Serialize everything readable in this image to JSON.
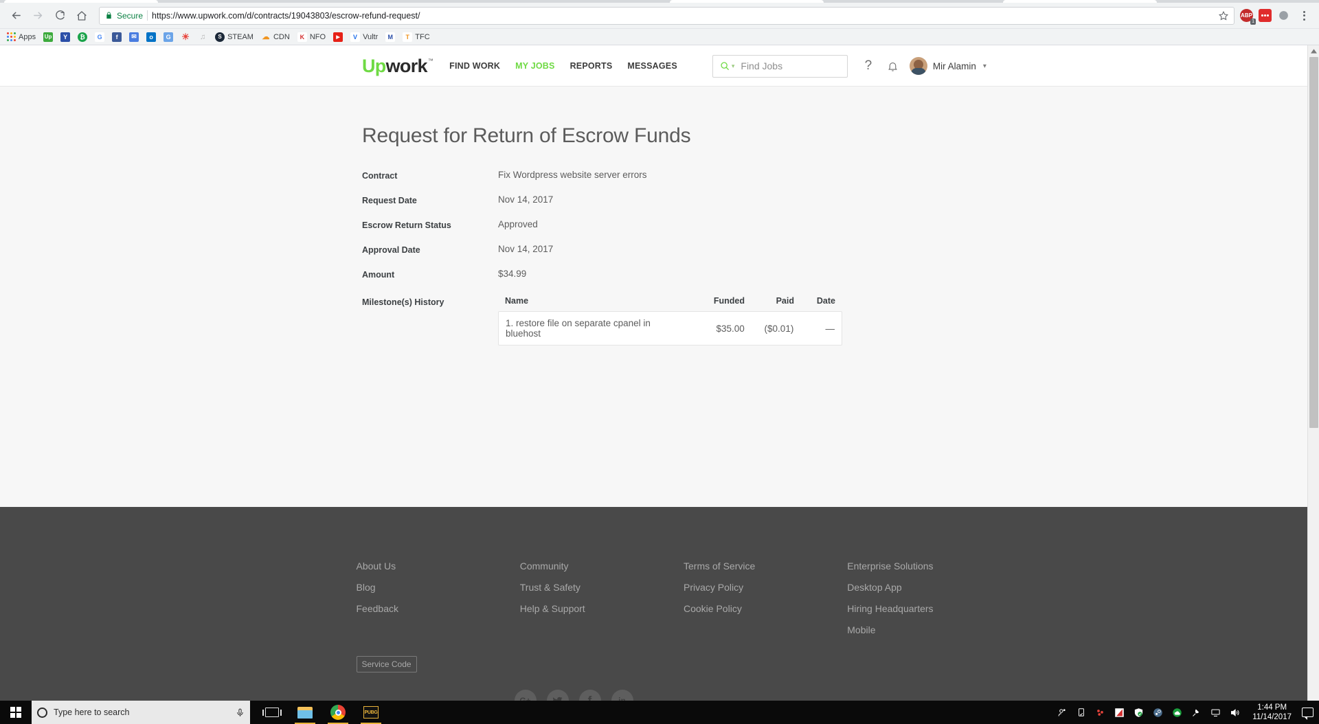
{
  "browser": {
    "nav": {
      "back": "back-arrow",
      "forward": "forward-arrow",
      "reload": "reload",
      "home": "home"
    },
    "security_label": "Secure",
    "url": "https://www.upwork.com/d/contracts/19043803/escrow-refund-request/",
    "extensions": [
      {
        "name": "adblock-plus",
        "label": "ABP",
        "badge": "1"
      },
      {
        "name": "red-dots-extension",
        "label": ""
      },
      {
        "name": "globe-extension",
        "label": ""
      }
    ],
    "bookmarks": [
      {
        "name": "apps",
        "label": "Apps",
        "icon": "apps-grid",
        "color": ""
      },
      {
        "name": "upwork",
        "label": "",
        "icon": "Up",
        "color": "#3caa3c"
      },
      {
        "name": "yahoo",
        "label": "",
        "icon": "Y",
        "color": "#2b4fa8"
      },
      {
        "name": "bitcoin",
        "label": "",
        "icon": "₿",
        "color": "#1aa34a"
      },
      {
        "name": "google",
        "label": "",
        "icon": "G",
        "color": "#ffffff"
      },
      {
        "name": "facebook",
        "label": "",
        "icon": "f",
        "color": "#3b5998"
      },
      {
        "name": "mail",
        "label": "",
        "icon": "✉",
        "color": "#4a7de0"
      },
      {
        "name": "outlook",
        "label": "",
        "icon": "o",
        "color": "#0072c6"
      },
      {
        "name": "google-docs",
        "label": "",
        "icon": "G",
        "color": "#4285f4"
      },
      {
        "name": "sun",
        "label": "",
        "icon": "☀",
        "color": "#e8473f"
      },
      {
        "name": "music",
        "label": "",
        "icon": "♪",
        "color": "#bdbdbd"
      },
      {
        "name": "steam",
        "label": "STEAM",
        "icon": "S",
        "color": "#1b2838"
      },
      {
        "name": "cdn",
        "label": "CDN",
        "icon": "▲",
        "color": "#f0941e"
      },
      {
        "name": "nfo",
        "label": "NFO",
        "icon": "K",
        "color": "#d32f2f"
      },
      {
        "name": "youtube",
        "label": "",
        "icon": "▶",
        "color": "#e62117"
      },
      {
        "name": "vultr",
        "label": "Vultr",
        "icon": "V",
        "color": "#ffffff"
      },
      {
        "name": "gmail-m",
        "label": "",
        "icon": "M",
        "color": "#ffffff"
      },
      {
        "name": "tfc",
        "label": "TFC",
        "icon": "T",
        "color": "#ffffff"
      }
    ]
  },
  "site": {
    "logo": {
      "up": "Up",
      "work": "work",
      "tm": "™"
    },
    "nav": [
      {
        "label": "FIND WORK",
        "active": false
      },
      {
        "label": "MY JOBS",
        "active": true
      },
      {
        "label": "REPORTS",
        "active": false
      },
      {
        "label": "MESSAGES",
        "active": false
      }
    ],
    "search_placeholder": "Find Jobs",
    "help_label": "?",
    "user_name": "Mir Alamin",
    "accent_color": "#6fda44"
  },
  "page": {
    "title": "Request for Return of Escrow Funds",
    "details": [
      {
        "label": "Contract",
        "value": "Fix Wordpress website server errors"
      },
      {
        "label": "Request Date",
        "value": "Nov 14, 2017"
      },
      {
        "label": "Escrow Return Status",
        "value": "Approved"
      },
      {
        "label": "Approval Date",
        "value": "Nov 14, 2017"
      },
      {
        "label": "Amount",
        "value": "$34.99"
      }
    ],
    "milestones": {
      "label": "Milestone(s) History",
      "columns": [
        "Name",
        "Funded",
        "Paid",
        "Date"
      ],
      "rows": [
        {
          "name": "1. restore file on separate cpanel in bluehost",
          "funded": "$35.00",
          "paid": "($0.01)",
          "date": "—"
        }
      ]
    }
  },
  "footer": {
    "columns": [
      {
        "links": [
          "About Us",
          "Blog",
          "Feedback"
        ]
      },
      {
        "links": [
          "Community",
          "Trust & Safety",
          "Help & Support"
        ]
      },
      {
        "links": [
          "Terms of Service",
          "Privacy Policy",
          "Cookie Policy"
        ]
      },
      {
        "links": [
          "Enterprise Solutions",
          "Desktop App",
          "Hiring Headquarters",
          "Mobile"
        ]
      }
    ],
    "service_code": "Service Code",
    "socials": [
      {
        "name": "google-plus",
        "glyph": "G+"
      },
      {
        "name": "twitter",
        "glyph": "🐦"
      },
      {
        "name": "facebook",
        "glyph": "f"
      },
      {
        "name": "linkedin",
        "glyph": "in"
      }
    ],
    "background_color": "#494949"
  },
  "taskbar": {
    "search_placeholder": "Type here to search",
    "apps": [
      {
        "name": "task-view",
        "open": false
      },
      {
        "name": "file-explorer",
        "open": true
      },
      {
        "name": "google-chrome",
        "open": true
      },
      {
        "name": "pubg",
        "open": true
      }
    ],
    "tray": [
      {
        "name": "people"
      },
      {
        "name": "usb-safely-remove"
      },
      {
        "name": "bluestacks"
      },
      {
        "name": "kaspersky"
      },
      {
        "name": "windows-defender"
      },
      {
        "name": "steam"
      },
      {
        "name": "onedrive"
      },
      {
        "name": "satellite"
      },
      {
        "name": "network"
      },
      {
        "name": "volume"
      }
    ],
    "time": "1:44 PM",
    "date": "11/14/2017"
  }
}
